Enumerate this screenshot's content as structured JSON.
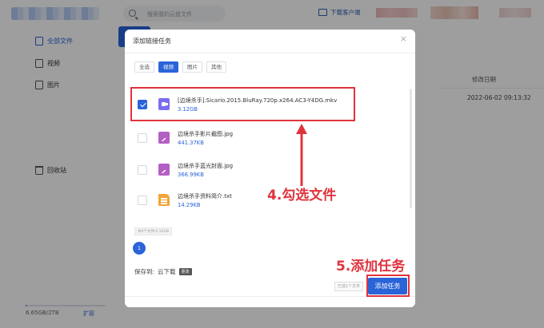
{
  "topbar": {
    "search_placeholder": "搜索我的云盘文件",
    "download_client": "下载客户端"
  },
  "sidebar": {
    "items": [
      {
        "label": "全部文件",
        "icon": "file-icon",
        "active": true
      },
      {
        "label": "视频",
        "icon": "video-icon",
        "active": false
      },
      {
        "label": "图片",
        "icon": "image-icon",
        "active": false
      },
      {
        "label": "回收站",
        "icon": "trash-icon",
        "active": false
      }
    ],
    "storage": "6.65GB/2TB",
    "expand": "扩容"
  },
  "main": {
    "col_modified": "修改日期",
    "row_date": "2022-06-02 09:13:32"
  },
  "modal": {
    "title": "添加链接任务",
    "close": "×",
    "tabs": [
      {
        "label": "全选",
        "active": false
      },
      {
        "label": "视频",
        "active": true
      },
      {
        "label": "图片",
        "active": false
      },
      {
        "label": "其他",
        "active": false
      }
    ],
    "files": [
      {
        "name": "[边境杀手].Sicario.2015.BluRay.720p.x264.AC3-Y4DG.mkv",
        "size": "3.12GB",
        "type": "video",
        "checked": true
      },
      {
        "name": "边境杀手影片截图.jpg",
        "size": "441.37KB",
        "type": "image",
        "checked": false
      },
      {
        "name": "边境杀手蓝光封面.jpg",
        "size": "366.99KB",
        "type": "image",
        "checked": false
      },
      {
        "name": "边境杀手资料简介.txt",
        "size": "14.29KB",
        "type": "text",
        "checked": false
      }
    ],
    "file_count": "共4个文件/3.12GB",
    "page": "1",
    "save_to_label": "保存到:",
    "save_to_value": "云下载",
    "change": "更改",
    "selected_count": "已选1个文件",
    "add_task": "添加任务"
  },
  "annotations": {
    "step4": "4.勾选文件",
    "step5": "5.添加任务"
  },
  "colors": {
    "accent": "#2a64d8",
    "annotation": "#e0333d"
  }
}
